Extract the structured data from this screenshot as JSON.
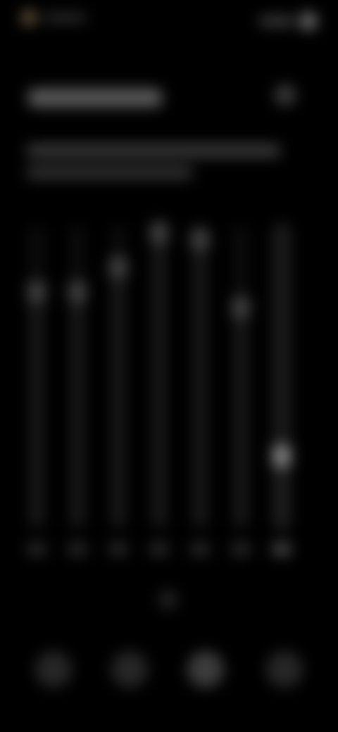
{
  "status_bar": {
    "left_icon": "app-dot-icon",
    "right_icon": "battery-icon"
  },
  "header": {
    "action_icon": "menu-icon"
  },
  "chart_data": {
    "type": "bar",
    "categories": [
      "",
      "",
      "",
      "",
      "",
      "",
      ""
    ],
    "values": [
      0.8,
      0.8,
      0.88,
      0.99,
      0.97,
      0.75,
      0.27
    ],
    "active_index": 6,
    "ylim": [
      0,
      1
    ]
  },
  "nav": {
    "items": [
      {
        "icon": "home-icon"
      },
      {
        "icon": "stats-icon"
      },
      {
        "icon": "add-icon"
      },
      {
        "icon": "profile-icon"
      }
    ],
    "selected_index": 2
  },
  "colors": {
    "background": "#000000",
    "bar_track": "#0e0e0e",
    "bar_cap": "#444444",
    "bar_cap_active": "#8a8a8a"
  }
}
